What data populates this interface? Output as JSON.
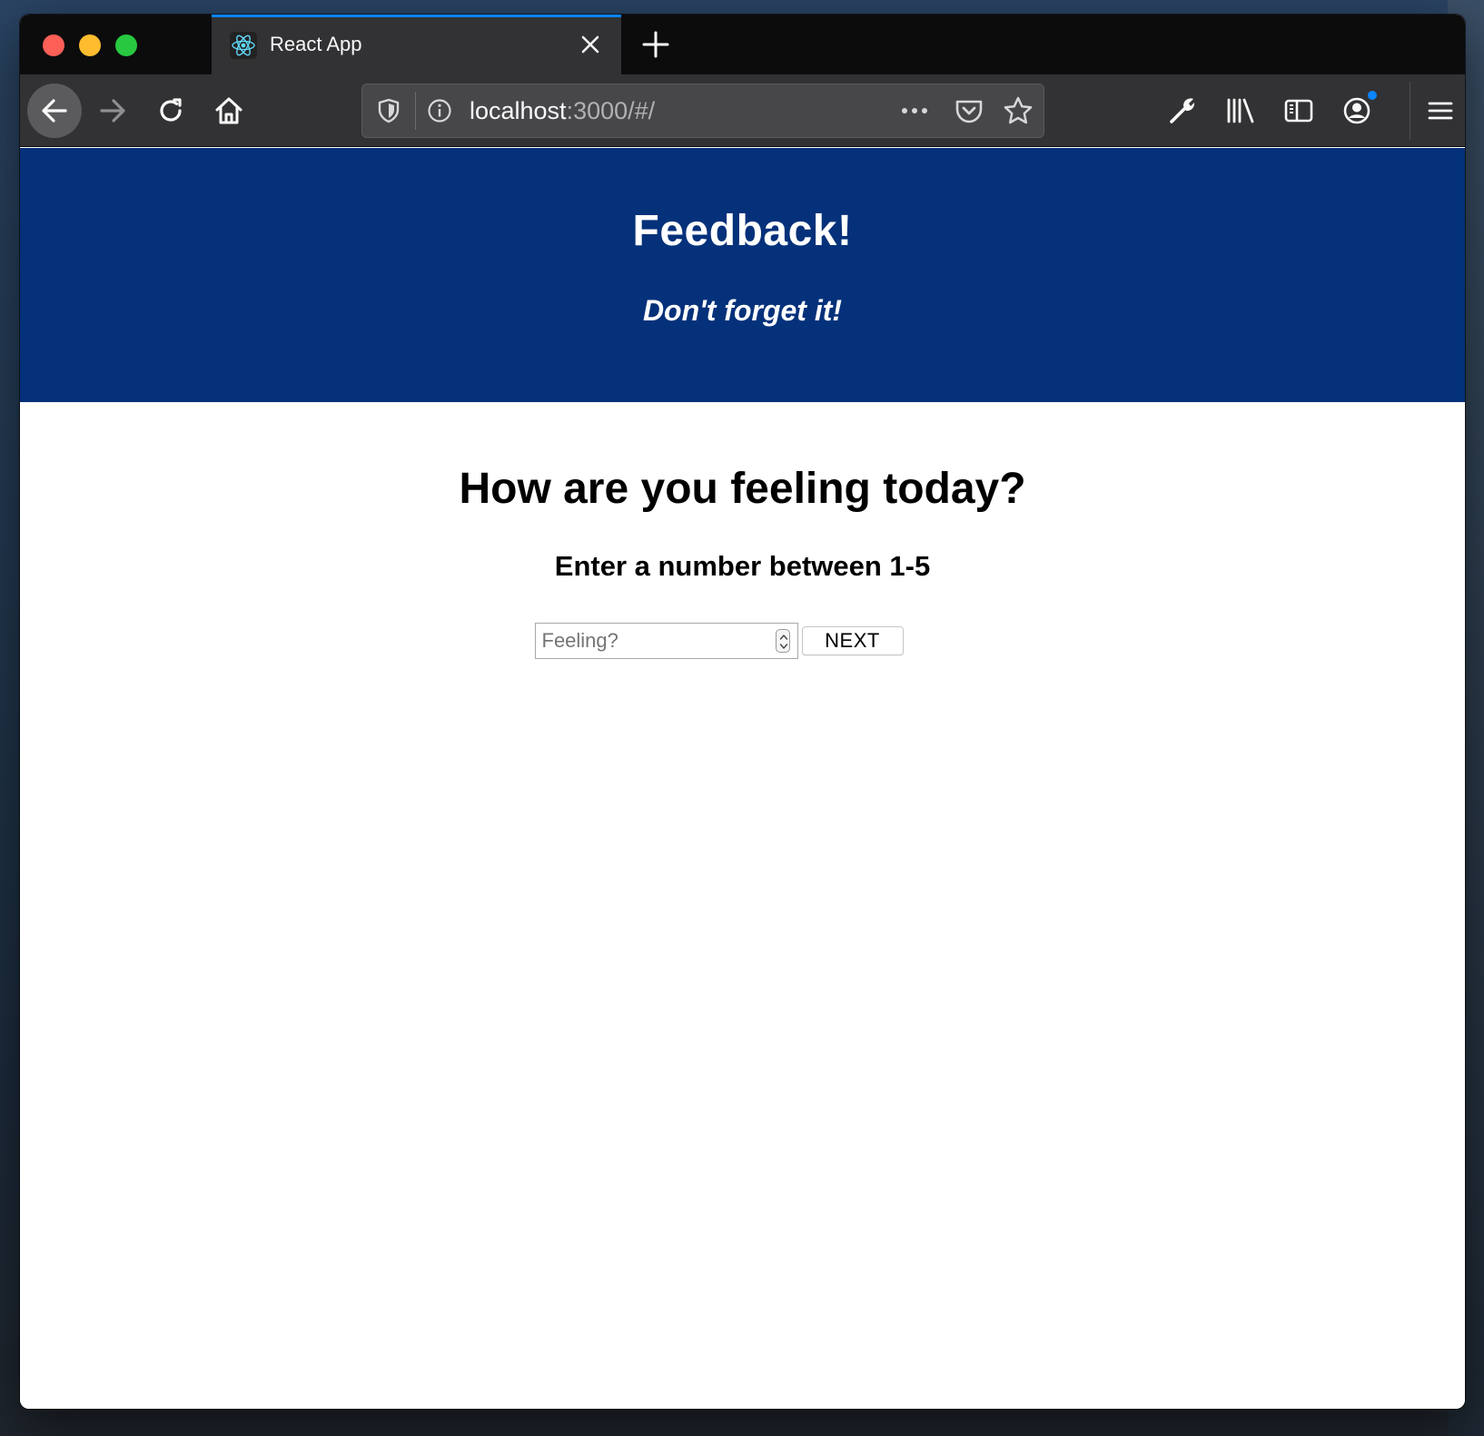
{
  "browser": {
    "tab_title": "React App",
    "tab_close_glyph": "×",
    "new_tab_glyph": "+",
    "url_host": "localhost",
    "url_rest": ":3000/#/",
    "url_more_glyph": "•••",
    "accent": "#0a84ff"
  },
  "app": {
    "header_bg": "#04317a",
    "title": "Feedback!",
    "subtitle": "Don't forget it!"
  },
  "main": {
    "question": "How are you feeling today?",
    "instructions": "Enter a number between 1-5",
    "input_placeholder": "Feeling?",
    "input_value": "",
    "next_label": "NEXT"
  }
}
